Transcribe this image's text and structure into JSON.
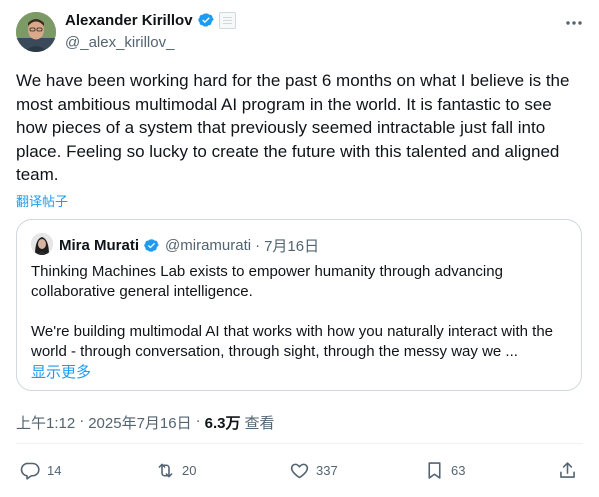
{
  "author": {
    "display_name": "Alexander Kirillov",
    "handle": "@_alex_kirillov_"
  },
  "tweet_text": "We have been working hard for the past 6 months on what I believe is the most ambitious multimodal AI program in the world. It is fantastic to see how pieces of a system that previously seemed intractable just fall into place. Feeling so lucky to create the future with this talented and aligned team.",
  "translate_label": "翻译帖子",
  "quote": {
    "display_name": "Mira Murati",
    "handle": "@miramurati",
    "separator": "·",
    "date": "7月16日",
    "paragraph_1": "Thinking Machines Lab exists to empower humanity through advancing collaborative general intelligence.",
    "paragraph_2": "We're building multimodal AI that works with how you naturally interact with the world - through conversation, through sight, through the messy way we ...",
    "show_more": "显示更多"
  },
  "meta": {
    "time": "上午1:12",
    "separator": "·",
    "date": "2025年7月16日",
    "separator2": "·",
    "views_count": "6.3万",
    "views_label": "查看"
  },
  "actions": {
    "replies": "14",
    "reposts": "20",
    "likes": "337",
    "bookmarks": "63"
  },
  "colors": {
    "accent": "#1d9bf0",
    "text": "#0f1419",
    "secondary": "#536471",
    "border": "#cfd9de"
  }
}
